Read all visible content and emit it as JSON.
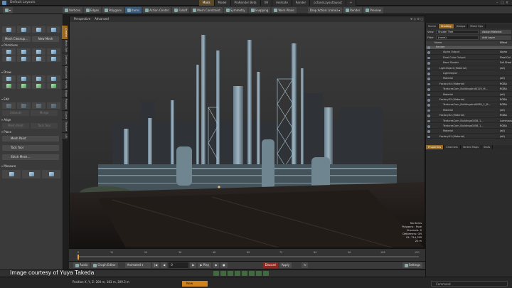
{
  "window": {
    "title": "Default Layouts"
  },
  "layout_tabs": [
    "Mods",
    "Model",
    "ProRender Beta",
    "VR",
    "Animate",
    "Render",
    "octaneLayoutlayout"
  ],
  "layout_plus": "+",
  "toolbar": {
    "items": [
      "Vertices",
      "Edges",
      "Polygons",
      "Items",
      "Action Center",
      "Falloff",
      "Mesh Constraint",
      "Symmetry",
      "Snapping",
      "Work Plane"
    ],
    "drop_action": "Drop Action: (none)",
    "render": "Render",
    "preview": "Preview"
  },
  "left_panel": {
    "tabs": [
      "Create",
      "Mesh Edit",
      "Deform",
      "Duplicate",
      "Vertex",
      "Edge",
      "Polygon",
      "Curve",
      "Texture",
      "UV"
    ],
    "cleanup_button": "Mesh Cleanup...",
    "new_mesh_button": "New Mesh",
    "sections": [
      "Primitives",
      "Draw",
      "Edit",
      "Align",
      "Place",
      "Measure"
    ],
    "edit_buttons": [
      "Unbevel",
      "Merge"
    ],
    "align_buttons": [
      "Mesh Paint",
      "Tack Tool"
    ],
    "place_tools": [
      "Mesh Paint",
      "Tack Tool",
      "Stitch Mesh..."
    ]
  },
  "viewport": {
    "view": "Perspective",
    "shading": "Advanced",
    "info": [
      "No Items",
      "Polygons : Face",
      "Channels: 0",
      "Deformers: ON",
      "GL: 714,789",
      "20 m"
    ]
  },
  "timeline": {
    "ticks": [
      "0",
      "12",
      "24",
      "36",
      "48",
      "60",
      "72",
      "84",
      "96",
      "108",
      "120"
    ]
  },
  "bottom_bar": {
    "audio": "Audio",
    "graph_editor": "Graph Editor",
    "animated": "Animated",
    "frame": "0",
    "play": "Play",
    "discard": "Discard",
    "apply": "Apply",
    "settings": "Settings"
  },
  "status": {
    "position": "Position X, Y, Z:  200 m, 183 m, 309.3 m",
    "new": "New",
    "command": "Command"
  },
  "credit": "Image courtesy of Yuya Takeda",
  "right_panel": {
    "top_tabs": [
      "Scene",
      "Shading",
      "Groups",
      "Mesh Ops"
    ],
    "filter_label": "Filter",
    "filter_value": "(none)",
    "view_label": "View",
    "view_value": "Shader Tree",
    "assign_material": "Assign Material",
    "add_layer": "Add Layer",
    "columns": [
      "Name",
      "Effect"
    ],
    "tree": [
      {
        "name": "Render",
        "effect": "",
        "indent": 0
      },
      {
        "name": "Alpha Output",
        "effect": "Alpha",
        "indent": 2
      },
      {
        "name": "Final Color Output",
        "effect": "Final Col",
        "indent": 2
      },
      {
        "name": "Base Shader",
        "effect": "Full Shad",
        "indent": 2
      },
      {
        "name": "LightObject (Material)",
        "effect": "(all)",
        "indent": 1
      },
      {
        "name": "LightObject",
        "effect": "",
        "indent": 2
      },
      {
        "name": "Material",
        "effect": "(all)",
        "indent": 2
      },
      {
        "name": "Factory04 (Material)",
        "effect": "RGBA",
        "indent": 1
      },
      {
        "name": "TexturesCom_BuildingsInd0125_M...",
        "effect": "RGBA",
        "indent": 2
      },
      {
        "name": "Material",
        "effect": "(all)",
        "indent": 2
      },
      {
        "name": "Factory03 (Material)",
        "effect": "RGBA",
        "indent": 1
      },
      {
        "name": "TexturesCom_BuildingsInd0065_1_M...",
        "effect": "RGBA",
        "indent": 2
      },
      {
        "name": "Material",
        "effect": "(all)",
        "indent": 2
      },
      {
        "name": "Factory02 (Material)",
        "effect": "RGBA",
        "indent": 1
      },
      {
        "name": "TexturesCom_Buildings0058_1...",
        "effect": "Luminous",
        "indent": 2
      },
      {
        "name": "TexturesCom_Buildings0058_1...",
        "effect": "RGBA",
        "indent": 2
      },
      {
        "name": "Material",
        "effect": "(all)",
        "indent": 2
      },
      {
        "name": "Factory01 (Material)",
        "effect": "(all)",
        "indent": 1
      }
    ],
    "bottom_tabs": [
      "Properties",
      "Channels",
      "Vertex Maps",
      "Stats"
    ]
  },
  "colors": {
    "accent": "#9b6a1f",
    "selected_tab": "#5b4a2a"
  }
}
